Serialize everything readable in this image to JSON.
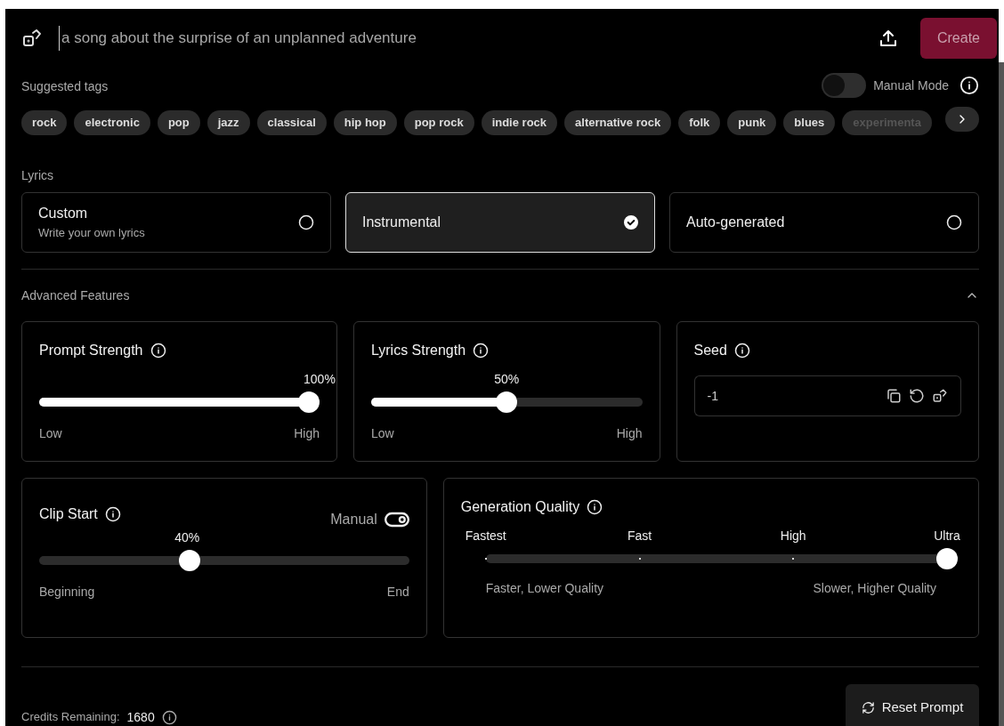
{
  "prompt": {
    "placeholder": "a song about the surprise of an unplanned adventure"
  },
  "create_button": "Create",
  "suggested_tags": {
    "title": "Suggested tags",
    "tags": [
      "rock",
      "electronic",
      "pop",
      "jazz",
      "classical",
      "hip hop",
      "pop rock",
      "indie rock",
      "alternative rock",
      "folk",
      "punk",
      "blues",
      "experimenta"
    ]
  },
  "manual_mode": {
    "label": "Manual Mode",
    "on": false
  },
  "lyrics": {
    "title": "Lyrics",
    "options": [
      {
        "label": "Custom",
        "sublabel": "Write your own lyrics",
        "selected": false
      },
      {
        "label": "Instrumental",
        "selected": true
      },
      {
        "label": "Auto-generated",
        "selected": false
      }
    ]
  },
  "advanced": {
    "title": "Advanced Features",
    "expanded": true
  },
  "prompt_strength": {
    "title": "Prompt Strength",
    "reading": "100%",
    "level": 1.0,
    "filled": true,
    "min_label": "Low",
    "max_label": "High"
  },
  "lyrics_strength": {
    "title": "Lyrics Strength",
    "reading": "50%",
    "level": 0.5,
    "filled": true,
    "min_label": "Low",
    "max_label": "High"
  },
  "seed": {
    "title": "Seed",
    "value": "-1"
  },
  "clip_start": {
    "title": "Clip Start",
    "manual_label": "Manual",
    "manual_on": true,
    "reading": "40%",
    "level": 0.4,
    "filled": false,
    "min_label": "Beginning",
    "max_label": "End"
  },
  "generation_quality": {
    "title": "Generation Quality",
    "options": [
      {
        "label": "Fastest",
        "selected": false
      },
      {
        "label": "Fast",
        "selected": false
      },
      {
        "label": "High",
        "selected": false
      },
      {
        "label": "Ultra",
        "selected": true
      }
    ],
    "min_label": "Faster, Lower Quality",
    "max_label": "Slower, Higher Quality"
  },
  "credits": {
    "label": "Credits Remaining:",
    "value": "1680"
  },
  "reset_button": "Reset Prompt"
}
